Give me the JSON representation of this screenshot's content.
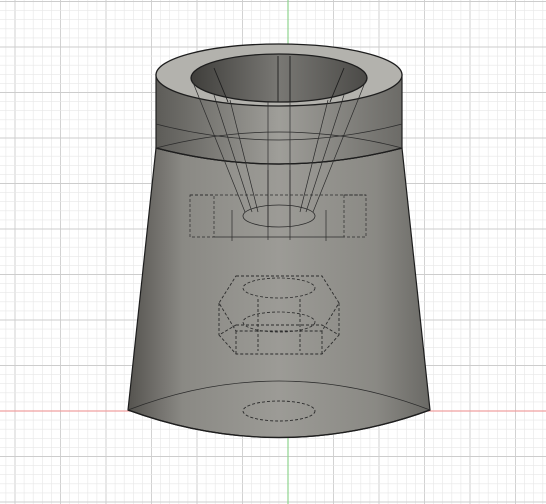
{
  "viewport": {
    "background": "#ffffff",
    "grid_minor_color": "#e7e7e7",
    "grid_major_color": "#cdcdcd",
    "axis_x_color": "#f0a0a0",
    "axis_y_color": "#8fd48f",
    "model_body_color": "#7b7a76",
    "model_edge_color": "#1e1e1e",
    "hidden_edge_color": "#2b2b2b"
  },
  "model": {
    "name": "cone-adapter",
    "features": [
      "top-ring",
      "conical-bore",
      "hex-nut-pocket",
      "bottom-hole"
    ]
  }
}
